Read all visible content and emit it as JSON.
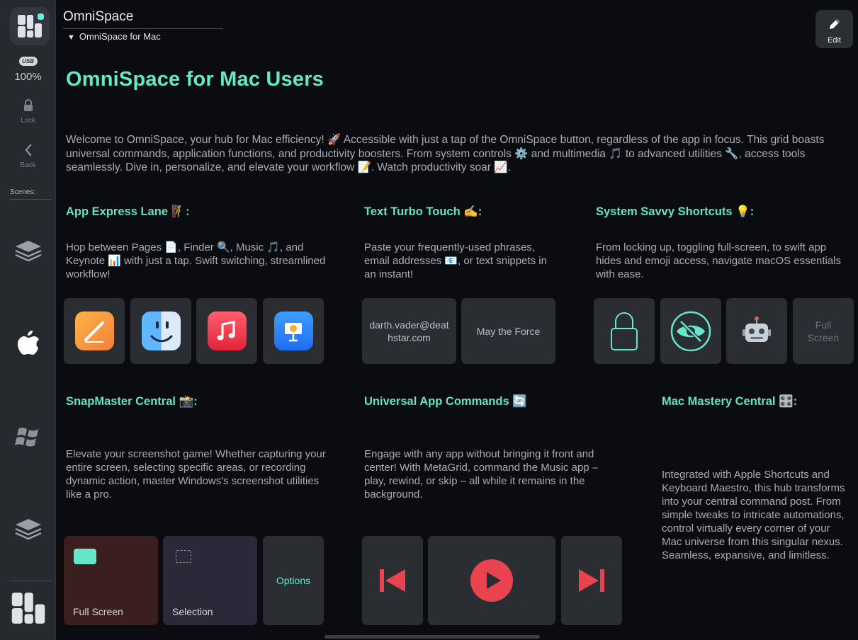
{
  "header": {
    "app_title": "OmniSpace",
    "subtitle": "OmniSpace for Mac",
    "edit_label": "Edit"
  },
  "sidebar": {
    "battery_badge": "USB",
    "battery_percent": "100%",
    "lock_label": "Lock",
    "back_label": "Back",
    "scenes_label": "Scenes:"
  },
  "main": {
    "page_title": "OmniSpace for Mac Users",
    "intro": "Welcome to OmniSpace, your hub for Mac efficiency! 🚀 Accessible with just a tap of the OmniSpace button, regardless of the app in focus. This grid boasts universal commands, application functions, and productivity boosters. From system controls ⚙️ and multimedia 🎵 to advanced utilities 🔧, access tools seamlessly. Dive in, personalize, and elevate your workflow 📝. Watch productivity soar 📈."
  },
  "sections": {
    "app_express": {
      "title": "App Express Lane 🧗:",
      "desc": "Hop between Pages 📄, Finder 🔍, Music 🎵, and Keynote 📊 with just a tap. Swift switching, streamlined workflow!"
    },
    "text_turbo": {
      "title": "Text Turbo Touch ✍️:",
      "desc": "Paste your frequently-used phrases, email addresses 📧, or text snippets in an instant!",
      "tile_email": "darth.vader@deathstar.com",
      "tile_phrase": "May the Force"
    },
    "system_savvy": {
      "title": "System Savvy Shortcuts 💡:",
      "desc": "From locking up, toggling full-screen, to swift app hides and emoji access, navigate macOS essentials with ease.",
      "tile_fullscreen": "Full Screen"
    },
    "snapmaster": {
      "title": "SnapMaster Central 📸:",
      "desc": "Elevate your screenshot game! Whether capturing your entire screen, selecting specific areas, or recording dynamic action, master Windows's screenshot utilities like a pro.",
      "tile_fullscreen": "Full Screen",
      "tile_selection": "Selection",
      "tile_options": "Options"
    },
    "universal": {
      "title": "Universal App Commands 🔄",
      "desc": "Engage with any app without bringing it front and center! With MetaGrid, command the Music app – play, rewind, or skip – all while it remains in the background."
    },
    "mac_mastery": {
      "title": "Mac Mastery Central 🎛️:",
      "desc": "Integrated with Apple Shortcuts and Keyboard Maestro, this hub transforms into your central command post. From simple tweaks to intricate automations, control virtually every corner of your Mac universe from this singular nexus. Seamless, expansive, and limitless."
    }
  },
  "colors": {
    "accent": "#64e9c8",
    "tile_bg": "#2a2d32",
    "fullscreen_tile_bg": "#3a1f1e",
    "selection_tile_bg": "#2d2838",
    "media_red": "#e8434f"
  }
}
